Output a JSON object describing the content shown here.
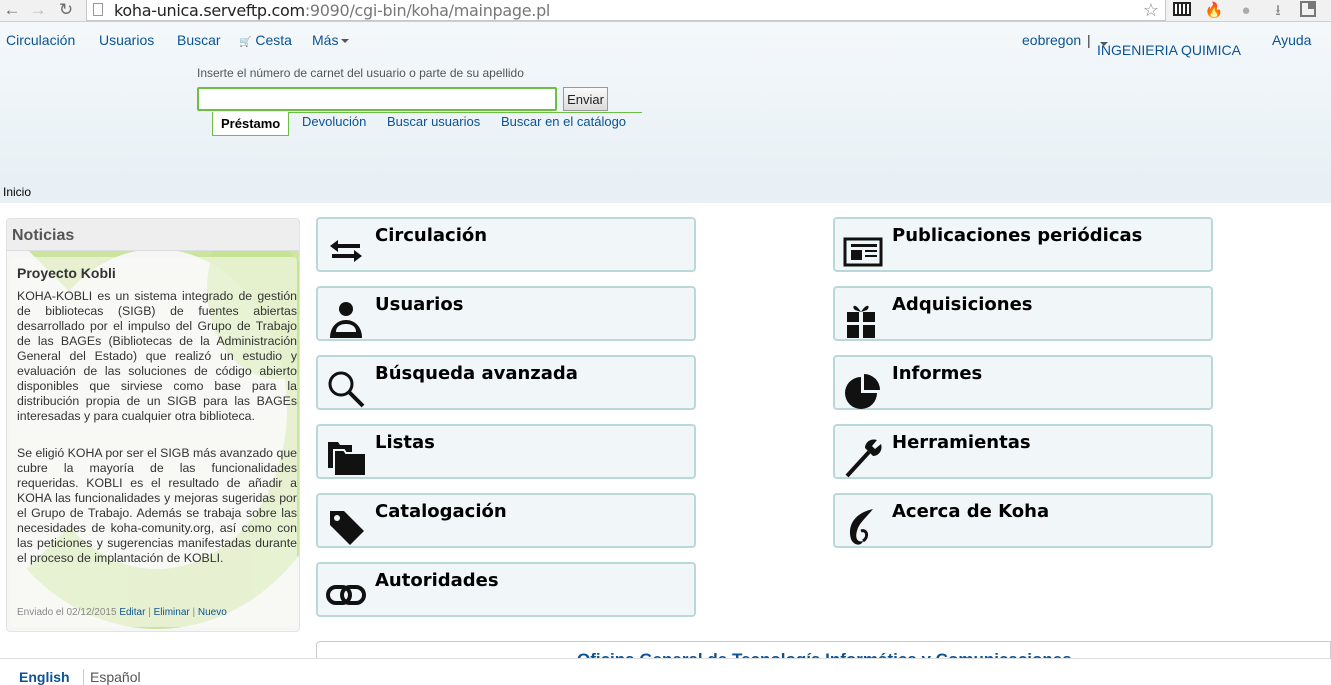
{
  "browser": {
    "url_host": "koha-unica.serveftp.com",
    "url_rest": ":9090/cgi-bin/koha/mainpage.pl"
  },
  "topnav": {
    "circulacion": "Circulación",
    "usuarios": "Usuarios",
    "buscar": "Buscar",
    "cesta": "Cesta",
    "mas": "Más"
  },
  "userbar": {
    "user": "eobregon",
    "separator": "|",
    "branch": "INGENIERIA QUIMICA",
    "help": "Ayuda"
  },
  "search": {
    "label": "Inserte el número de carnet del usuario o parte de su apellido",
    "value": "",
    "submit": "Enviar",
    "tabs": [
      "Préstamo",
      "Devolución",
      "Buscar usuarios",
      "Buscar en el catálogo"
    ]
  },
  "breadcrumb": "Inicio",
  "news": {
    "heading": "Noticias",
    "title": "Proyecto Kobli",
    "para1": "KOHA-KOBLI es un sistema integrado de gestión de bibliotecas (SIGB) de fuentes abiertas desarrollado por el impulso del Grupo de Trabajo de las BAGEs (Bibliotecas de la Administración General del Estado) que realizó un estudio y evaluación de las soluciones de código abierto disponibles que sirviese como base para la distribución propia de un SIGB para las BAGEs interesadas y para cualquier otra biblioteca.",
    "para2": "Se eligió KOHA por ser el SIGB más avanzado que cubre la mayoría de las funcionalidades requeridas. KOBLI es el resultado de añadir a KOHA las funcionalidades y mejoras sugeridas por el Grupo de Trabajo. Además se trabaja sobre las necesidades de koha-comunity.org, así como con las peticiones y sugerencias manifestadas durante el proceso de implantación de KOBLI.",
    "posted": "Enviado el 02/12/2015",
    "edit": "Editar",
    "delete": "Eliminar",
    "new": "Nuevo"
  },
  "modules": {
    "circulacion": "Circulación",
    "usuarios": "Usuarios",
    "busqueda": "Búsqueda avanzada",
    "listas": "Listas",
    "catalogacion": "Catalogación",
    "autoridades": "Autoridades",
    "publicaciones": "Publicaciones periódicas",
    "adquisiciones": "Adquisiciones",
    "informes": "Informes",
    "herramientas": "Herramientas",
    "acerca": "Acerca de Koha"
  },
  "footer_text": "Oficina General de Tecnología Informática y Comunicaciones",
  "languages": {
    "english": "English",
    "spanish": "Español"
  }
}
